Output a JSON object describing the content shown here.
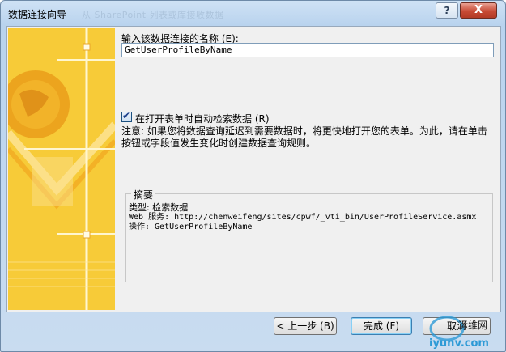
{
  "window": {
    "title": "数据连接向导",
    "ghost_title": "从 SharePoint 列表或库接收数据",
    "help_label": "?",
    "close_label": "X"
  },
  "form": {
    "name_label": "输入该数据连接的名称 (E):",
    "name_value": "GetUserProfileByName",
    "auto_retrieve_checked": true,
    "auto_retrieve_label": "在打开表单时自动检索数据 (R)",
    "note": "注意: 如果您将数据查询延迟到需要数据时，将更快地打开您的表单。为此，请在单击按钮或字段值发生变化时创建数据查询规则。"
  },
  "summary": {
    "title": "摘要",
    "type_line": "类型: 检索数据",
    "web_service_line": "Web 服务: http://chenweifeng/sites/cpwf/_vti_bin/UserProfileService.asmx",
    "operation_line": "操作: GetUserProfileByName"
  },
  "buttons": {
    "back": "< 上一步 (B)",
    "finish": "完成 (F)",
    "cancel": "取消"
  },
  "watermark": {
    "text1": "运维网",
    "text2": "iyunv.com"
  },
  "colors": {
    "art_yellow": "#f6c427",
    "art_orange": "#f0a01a",
    "finish_border": "#3c7fb1",
    "close_red": "#c74a35"
  }
}
